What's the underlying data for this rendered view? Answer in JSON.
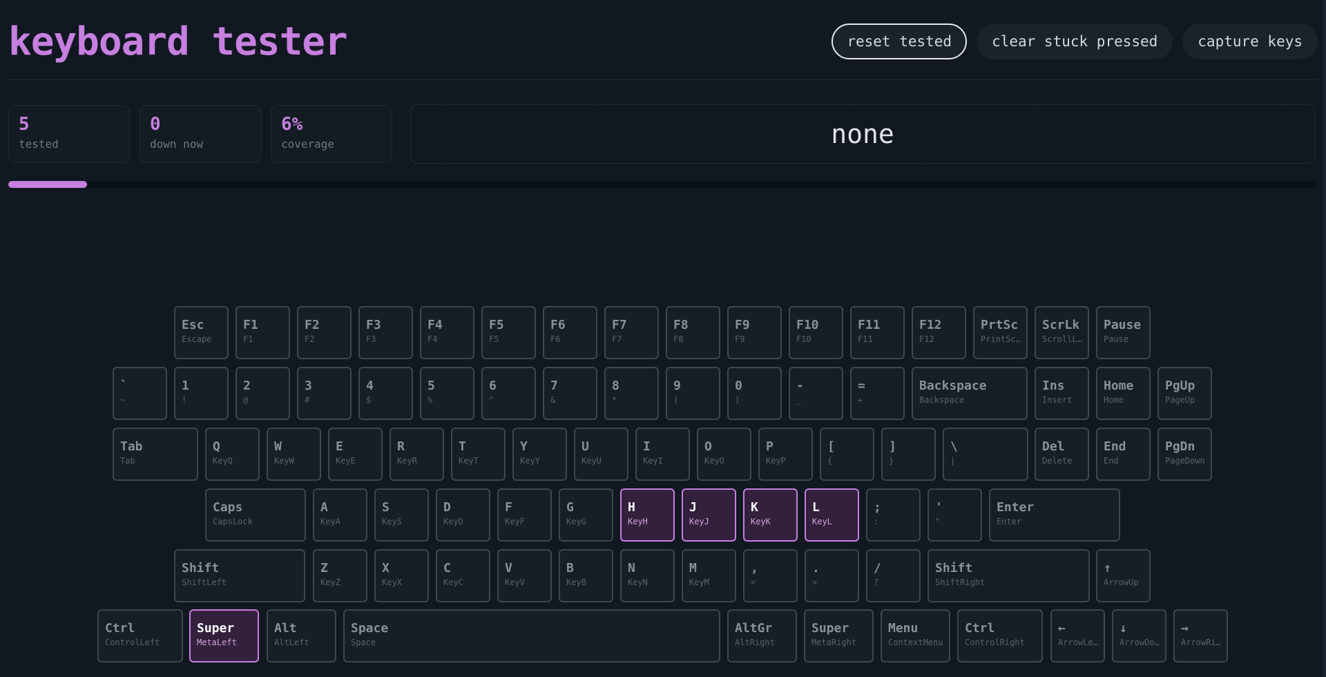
{
  "title": "keyboard tester",
  "buttons": {
    "reset": "reset tested",
    "clear": "clear stuck pressed",
    "capture": "capture keys"
  },
  "stats": {
    "tested": {
      "value": "5",
      "label": "tested"
    },
    "down": {
      "value": "0",
      "label": "down now"
    },
    "coverage": {
      "value": "6%",
      "label": "coverage"
    }
  },
  "last_key": "none",
  "progress": 6,
  "colors": {
    "accent": "#c77fe0",
    "background": "#111821",
    "key_border": "#3f4650",
    "tested_bg": "#33203d"
  },
  "keyboard": {
    "rows": [
      [
        {
          "label": "Esc",
          "sub": "Escape"
        },
        {
          "label": "F1",
          "sub": "F1"
        },
        {
          "label": "F2",
          "sub": "F2"
        },
        {
          "label": "F3",
          "sub": "F3"
        },
        {
          "label": "F4",
          "sub": "F4"
        },
        {
          "label": "F5",
          "sub": "F5"
        },
        {
          "label": "F6",
          "sub": "F6"
        },
        {
          "label": "F7",
          "sub": "F7"
        },
        {
          "label": "F8",
          "sub": "F8"
        },
        {
          "label": "F9",
          "sub": "F9"
        },
        {
          "label": "F10",
          "sub": "F10"
        },
        {
          "label": "F11",
          "sub": "F11"
        },
        {
          "label": "F12",
          "sub": "F12"
        },
        {
          "label": "PrtSc",
          "sub": "PrintSc…"
        },
        {
          "label": "ScrLk",
          "sub": "ScrollL…"
        },
        {
          "label": "Pause",
          "sub": "Pause"
        }
      ],
      [
        {
          "label": "`",
          "sub": "~"
        },
        {
          "label": "1",
          "sub": "!"
        },
        {
          "label": "2",
          "sub": "@"
        },
        {
          "label": "3",
          "sub": "#"
        },
        {
          "label": "4",
          "sub": "$"
        },
        {
          "label": "5",
          "sub": "%"
        },
        {
          "label": "6",
          "sub": "^"
        },
        {
          "label": "7",
          "sub": "&"
        },
        {
          "label": "8",
          "sub": "*"
        },
        {
          "label": "9",
          "sub": "("
        },
        {
          "label": "0",
          "sub": ")"
        },
        {
          "label": "-",
          "sub": "_"
        },
        {
          "label": "=",
          "sub": "+"
        },
        {
          "label": "Backspace",
          "sub": "Backspace"
        },
        {
          "label": "Ins",
          "sub": "Insert"
        },
        {
          "label": "Home",
          "sub": "Home"
        },
        {
          "label": "PgUp",
          "sub": "PageUp"
        }
      ],
      [
        {
          "label": "Tab",
          "sub": "Tab"
        },
        {
          "label": "Q",
          "sub": "KeyQ"
        },
        {
          "label": "W",
          "sub": "KeyW"
        },
        {
          "label": "E",
          "sub": "KeyE"
        },
        {
          "label": "R",
          "sub": "KeyR"
        },
        {
          "label": "T",
          "sub": "KeyT"
        },
        {
          "label": "Y",
          "sub": "KeyY"
        },
        {
          "label": "U",
          "sub": "KeyU"
        },
        {
          "label": "I",
          "sub": "KeyI"
        },
        {
          "label": "O",
          "sub": "KeyO"
        },
        {
          "label": "P",
          "sub": "KeyP"
        },
        {
          "label": "[",
          "sub": "{"
        },
        {
          "label": "]",
          "sub": "}"
        },
        {
          "label": "\\",
          "sub": "|"
        },
        {
          "label": "Del",
          "sub": "Delete"
        },
        {
          "label": "End",
          "sub": "End"
        },
        {
          "label": "PgDn",
          "sub": "PageDown"
        }
      ],
      [
        {
          "label": "Caps",
          "sub": "CapsLock"
        },
        {
          "label": "A",
          "sub": "KeyA"
        },
        {
          "label": "S",
          "sub": "KeyS"
        },
        {
          "label": "D",
          "sub": "KeyD"
        },
        {
          "label": "F",
          "sub": "KeyF"
        },
        {
          "label": "G",
          "sub": "KeyG"
        },
        {
          "label": "H",
          "sub": "KeyH",
          "tested": true
        },
        {
          "label": "J",
          "sub": "KeyJ",
          "tested": true
        },
        {
          "label": "K",
          "sub": "KeyK",
          "tested": true
        },
        {
          "label": "L",
          "sub": "KeyL",
          "tested": true
        },
        {
          "label": ";",
          "sub": ":"
        },
        {
          "label": "'",
          "sub": "\""
        },
        {
          "label": "Enter",
          "sub": "Enter"
        }
      ],
      [
        {
          "label": "Shift",
          "sub": "ShiftLeft"
        },
        {
          "label": "Z",
          "sub": "KeyZ"
        },
        {
          "label": "X",
          "sub": "KeyX"
        },
        {
          "label": "C",
          "sub": "KeyC"
        },
        {
          "label": "V",
          "sub": "KeyV"
        },
        {
          "label": "B",
          "sub": "KeyB"
        },
        {
          "label": "N",
          "sub": "KeyN"
        },
        {
          "label": "M",
          "sub": "KeyM"
        },
        {
          "label": ",",
          "sub": "<"
        },
        {
          "label": ".",
          "sub": ">"
        },
        {
          "label": "/",
          "sub": "?"
        },
        {
          "label": "Shift",
          "sub": "ShiftRight"
        },
        {
          "label": "↑",
          "sub": "ArrowUp"
        }
      ],
      [
        {
          "label": "Ctrl",
          "sub": "ControlLeft"
        },
        {
          "label": "Super",
          "sub": "MetaLeft",
          "tested": true
        },
        {
          "label": "Alt",
          "sub": "AltLeft"
        },
        {
          "label": "Space",
          "sub": "Space"
        },
        {
          "label": "AltGr",
          "sub": "AltRight"
        },
        {
          "label": "Super",
          "sub": "MetaRight"
        },
        {
          "label": "Menu",
          "sub": "ContextMenu"
        },
        {
          "label": "Ctrl",
          "sub": "ControlRight"
        },
        {
          "label": "←",
          "sub": "ArrowLe…"
        },
        {
          "label": "↓",
          "sub": "ArrowDo…"
        },
        {
          "label": "→",
          "sub": "ArrowRi…"
        }
      ]
    ]
  }
}
